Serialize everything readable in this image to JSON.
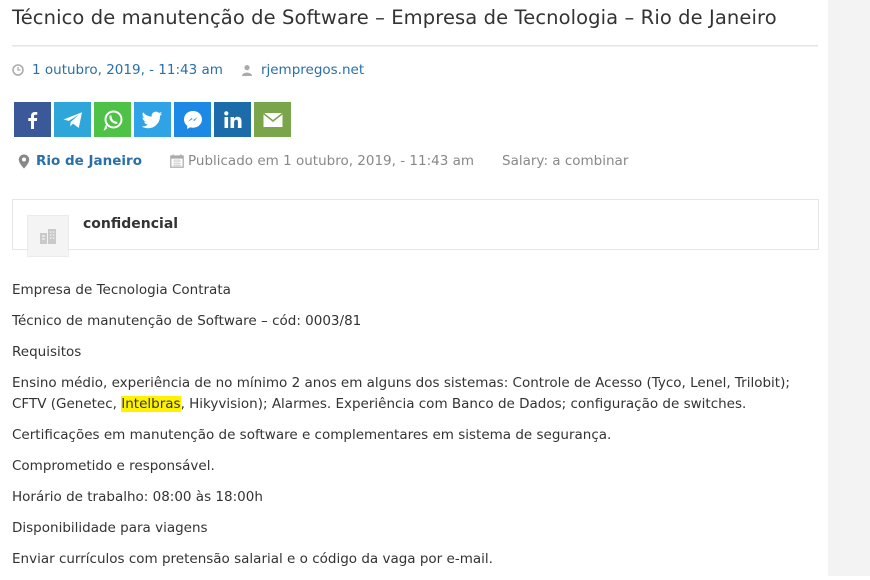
{
  "title": "Técnico de manutenção de Software – Empresa de Tecnologia – Rio de Janeiro",
  "meta": {
    "date": "1 outubro, 2019, - 11:43 am",
    "author": "rjempregos.net",
    "clock_icon": "clock-icon",
    "user_icon": "user-icon"
  },
  "share": [
    {
      "name": "facebook",
      "icon": "facebook-icon",
      "color": "#3b5998"
    },
    {
      "name": "telegram",
      "icon": "telegram-icon",
      "color": "#2ea6da"
    },
    {
      "name": "whatsapp",
      "icon": "whatsapp-icon",
      "color": "#4dc247"
    },
    {
      "name": "twitter",
      "icon": "twitter-icon",
      "color": "#2fa3e6"
    },
    {
      "name": "messenger",
      "icon": "messenger-icon",
      "color": "#1e88e5"
    },
    {
      "name": "linkedin",
      "icon": "linkedin-icon",
      "color": "#1b6ca8"
    },
    {
      "name": "email",
      "icon": "email-icon",
      "color": "#7aa54a"
    }
  ],
  "job": {
    "location": "Rio de Janeiro",
    "published": "Publicado em 1 outubro, 2019, - 11:43 am",
    "salary": "Salary: a combinar"
  },
  "company": {
    "name": "confidencial"
  },
  "description": {
    "p1": "Empresa de Tecnologia Contrata",
    "p2": "Técnico de manutenção de Software – cód: 0003/81",
    "p3": "Requisitos",
    "p4_before": "Ensino médio, experiência de no mínimo 2 anos em alguns dos sistemas: Controle de Acesso (Tyco, Lenel, Trilobit); CFTV (Genetec, ",
    "p4_highlight": "Intelbras",
    "p4_after": ", Hikyvision); Alarmes. Experiência com Banco de Dados; configuração de switches.",
    "p5": "Certificações em manutenção de software e complementares em sistema de segurança.",
    "p6": "Comprometido e responsável.",
    "p7": "Horário de trabalho: 08:00 às 18:00h",
    "p8": "Disponibilidade para viagens",
    "p9": "Enviar currículos com pretensão salarial e o código da vaga por e-mail."
  }
}
